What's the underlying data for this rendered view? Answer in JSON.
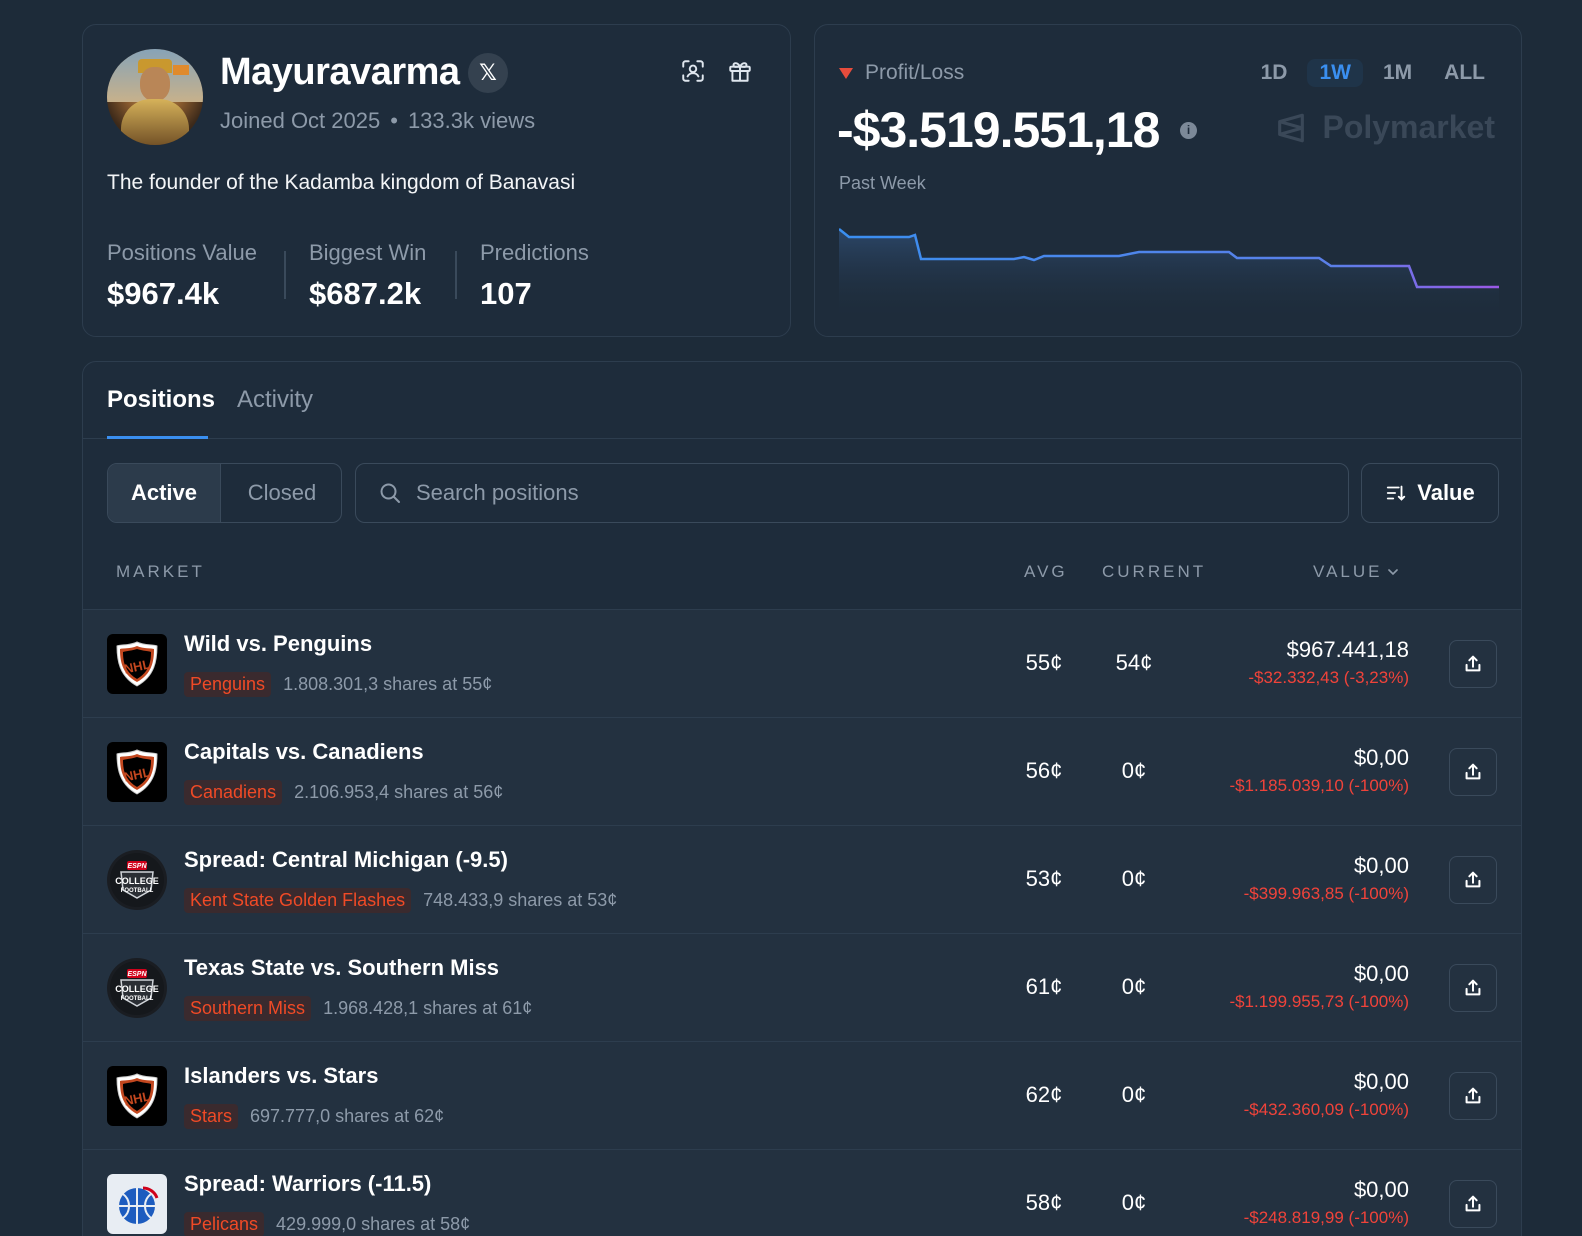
{
  "profile": {
    "username": "Mayuravarma",
    "x_badge": "𝕏",
    "joined": "Joined Oct 2025",
    "dot": "•",
    "views": "133.3k views",
    "bio": "The founder of the Kadamba kingdom of Banavasi",
    "stats": [
      {
        "label": "Positions Value",
        "value": "$967.4k"
      },
      {
        "label": "Biggest Win",
        "value": "$687.2k"
      },
      {
        "label": "Predictions",
        "value": "107"
      }
    ]
  },
  "pnl": {
    "title": "Profit/Loss",
    "value": "-$3.519.551,18",
    "info": "i",
    "brand": "Polymarket",
    "period": "Past Week",
    "ranges": [
      "1D",
      "1W",
      "1M",
      "ALL"
    ],
    "active_range": "1W",
    "line_colors": [
      "#3a8ff0",
      "#9b59e6"
    ]
  },
  "tabs": {
    "positions": "Positions",
    "activity": "Activity"
  },
  "filters": {
    "active": "Active",
    "closed": "Closed",
    "search_placeholder": "Search positions",
    "sort_label": "Value"
  },
  "columns": {
    "market": "MARKET",
    "avg": "AVG",
    "current": "CURRENT",
    "value": "VALUE"
  },
  "rows": [
    {
      "logo": "nhl-logo",
      "market": "Wild vs. Penguins",
      "outcome": "Penguins",
      "shares": "1.808.301,3 shares at 55¢",
      "avg": "55¢",
      "current": "54¢",
      "value": "$967.441,18",
      "pnl": "-$32.332,43 (-3,23%)"
    },
    {
      "logo": "nhl-logo",
      "market": "Capitals vs. Canadiens",
      "outcome": "Canadiens",
      "shares": "2.106.953,4 shares at 56¢",
      "avg": "56¢",
      "current": "0¢",
      "value": "$0,00",
      "pnl": "-$1.185.039,10 (-100%)"
    },
    {
      "logo": "college-football-logo",
      "market": "Spread: Central Michigan (-9.5)",
      "outcome": "Kent State Golden Flashes",
      "shares": "748.433,9 shares at 53¢",
      "avg": "53¢",
      "current": "0¢",
      "value": "$0,00",
      "pnl": "-$399.963,85 (-100%)"
    },
    {
      "logo": "college-football-logo",
      "market": "Texas State vs. Southern Miss",
      "outcome": "Southern Miss",
      "shares": "1.968.428,1 shares at 61¢",
      "avg": "61¢",
      "current": "0¢",
      "value": "$0,00",
      "pnl": "-$1.199.955,73 (-100%)"
    },
    {
      "logo": "nhl-logo",
      "market": "Islanders vs. Stars",
      "outcome": "Stars",
      "shares": "697.777,0 shares at 62¢",
      "avg": "62¢",
      "current": "0¢",
      "value": "$0,00",
      "pnl": "-$432.360,09 (-100%)"
    },
    {
      "logo": "nba-logo",
      "market": "Spread: Warriors (-11.5)",
      "outcome": "Pelicans",
      "shares": "429.999,0 shares at 58¢",
      "avg": "58¢",
      "current": "0¢",
      "value": "$0,00",
      "pnl": "-$248.819,99 (-100%)"
    }
  ],
  "colors": {
    "background": "#1d2b39",
    "accent": "#3a8ff0",
    "loss": "#f0433a",
    "outcome": "#f04a26"
  }
}
